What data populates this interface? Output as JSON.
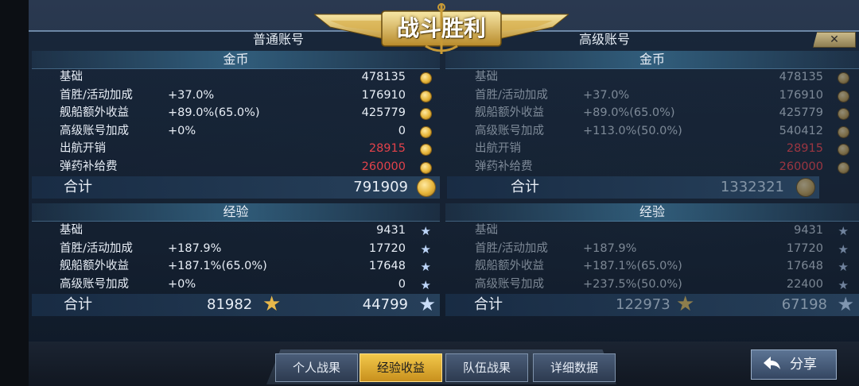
{
  "title": "战斗胜利",
  "close_label": "✕",
  "columns": {
    "left_header": "普通账号",
    "right_header": "高级账号"
  },
  "sections": {
    "gold": "金币",
    "exp": "经验"
  },
  "total_label": "合计",
  "left": {
    "gold_rows": [
      {
        "label": "基础",
        "pct": "",
        "value": "478135"
      },
      {
        "label": "首胜/活动加成",
        "pct": "+37.0%",
        "value": "176910"
      },
      {
        "label": "舰船额外收益",
        "pct": "+89.0%(65.0%)",
        "value": "425779"
      },
      {
        "label": "高级账号加成",
        "pct": "+0%",
        "value": "0"
      },
      {
        "label": "出航开销",
        "pct": "",
        "value": "28915"
      },
      {
        "label": "弹药补给费",
        "pct": "",
        "value": "260000"
      }
    ],
    "gold_total": "791909",
    "exp_rows": [
      {
        "label": "基础",
        "pct": "",
        "value": "9431"
      },
      {
        "label": "首胜/活动加成",
        "pct": "+187.9%",
        "value": "17720"
      },
      {
        "label": "舰船额外收益",
        "pct": "+187.1%(65.0%)",
        "value": "17648"
      },
      {
        "label": "高级账号加成",
        "pct": "+0%",
        "value": "0"
      }
    ],
    "exp_total_captain": "81982",
    "exp_total": "44799"
  },
  "right": {
    "gold_rows": [
      {
        "label": "基础",
        "pct": "",
        "value": "478135"
      },
      {
        "label": "首胜/活动加成",
        "pct": "+37.0%",
        "value": "176910"
      },
      {
        "label": "舰船额外收益",
        "pct": "+89.0%(65.0%)",
        "value": "425779"
      },
      {
        "label": "高级账号加成",
        "pct": "+113.0%(50.0%)",
        "value": "540412"
      },
      {
        "label": "出航开销",
        "pct": "",
        "value": "28915"
      },
      {
        "label": "弹药补给费",
        "pct": "",
        "value": "260000"
      }
    ],
    "gold_total": "1332321",
    "exp_rows": [
      {
        "label": "基础",
        "pct": "",
        "value": "9431"
      },
      {
        "label": "首胜/活动加成",
        "pct": "+187.9%",
        "value": "17720"
      },
      {
        "label": "舰船额外收益",
        "pct": "+187.1%(65.0%)",
        "value": "17648"
      },
      {
        "label": "高级账号加成",
        "pct": "+237.5%(50.0%)",
        "value": "22400"
      }
    ],
    "exp_total_captain": "122973",
    "exp_total": "67198"
  },
  "tabs": [
    "个人战果",
    "经验收益",
    "队伍战果",
    "详细数据"
  ],
  "active_tab": "经验收益",
  "share_label": "分享",
  "colors": {
    "expense": "#e2424a",
    "active_tab": "#f2c84b",
    "accent": "#6c87a6"
  }
}
